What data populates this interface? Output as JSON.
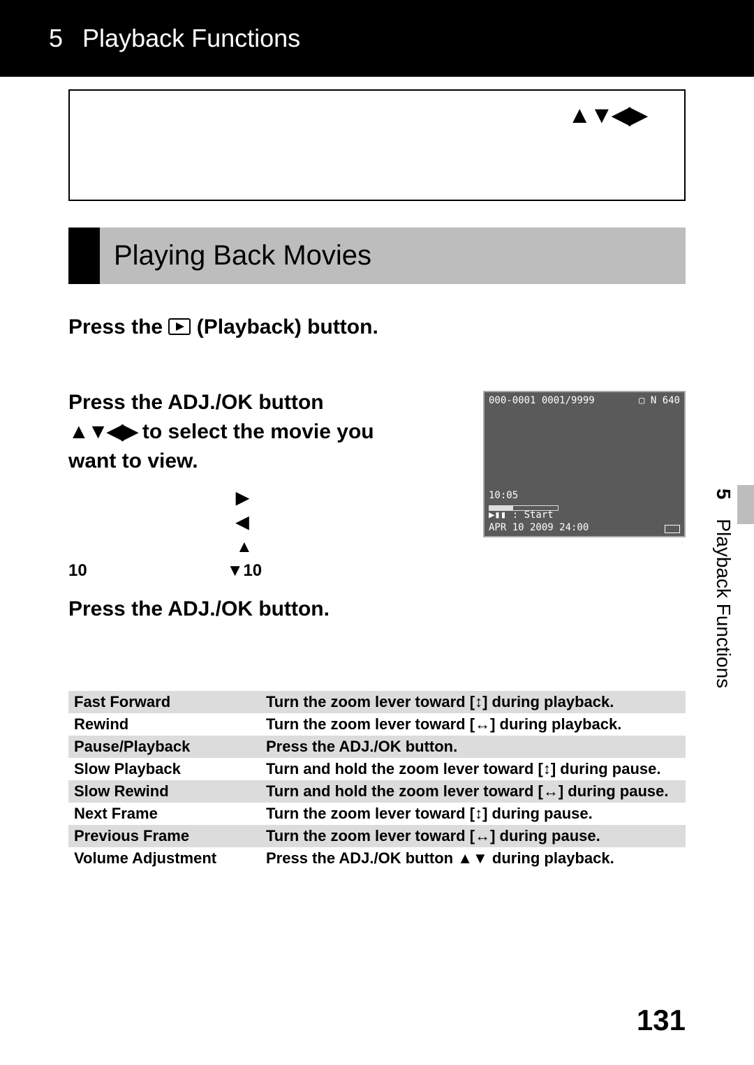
{
  "header": {
    "chapter_num": "5",
    "title": "Playback Functions"
  },
  "note_arrows": "▲▼◀▶",
  "section_title": "Playing Back Movies",
  "step1": {
    "pre": "Press the ",
    "post": " (Playback) button."
  },
  "step2": {
    "line1": "Press the ADJ./OK button",
    "arrows": "▲▼◀▶",
    "line2_rest": " to select the movie you",
    "line3": "want to view.",
    "nav_right": "▶",
    "nav_left": "◀",
    "nav_up": "▲",
    "nav_up_pre": "10",
    "nav_down": "▼10"
  },
  "preview": {
    "topline": "000-0001 0001/9999",
    "topright": "▢ N  640",
    "time": "10:05",
    "start": "▶▮▮ : Start",
    "date": "APR 10 2009 24:00"
  },
  "step3": "Press the ADJ./OK button.",
  "controls": [
    {
      "label": "Fast Forward",
      "desc": "Turn the zoom lever toward [↕] during playback.",
      "shade": true
    },
    {
      "label": "Rewind",
      "desc": "Turn the zoom lever toward [↔] during playback.",
      "shade": false
    },
    {
      "label": "Pause/Playback",
      "desc": "Press the ADJ./OK button.",
      "shade": true
    },
    {
      "label": "Slow Playback",
      "desc": "Turn and hold the zoom lever toward [↕] during pause.",
      "shade": false
    },
    {
      "label": "Slow Rewind",
      "desc": "Turn and hold the zoom lever toward [↔] during pause.",
      "shade": true
    },
    {
      "label": "Next Frame",
      "desc": "Turn the zoom lever toward [↕] during pause.",
      "shade": false
    },
    {
      "label": "Previous Frame",
      "desc": "Turn the zoom lever toward [↔] during pause.",
      "shade": true
    },
    {
      "label": "Volume Adjustment",
      "desc": "Press the ADJ./OK button ▲▼ during playback.",
      "shade": false
    }
  ],
  "side": {
    "chapter": "5",
    "label": "Playback Functions"
  },
  "page_number": "131"
}
